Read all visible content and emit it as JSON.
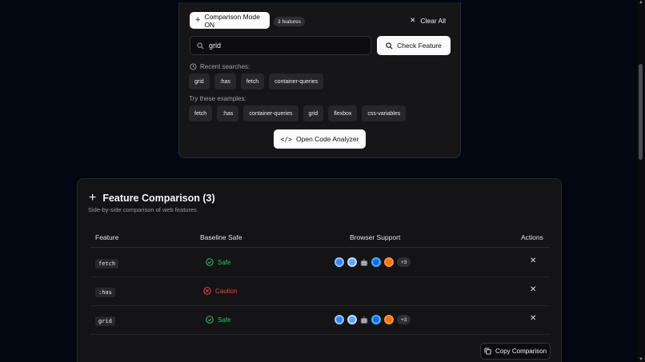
{
  "comparison_button": {
    "label": "Comparison Mode ON"
  },
  "features_badge": "3 features",
  "clear_all": "Clear All",
  "search": {
    "value": "grid",
    "placeholder": ""
  },
  "check_button": "Check Feature",
  "recent": {
    "label": "Recent searches:",
    "items": [
      "grid",
      ":has",
      "fetch",
      "container-queries"
    ]
  },
  "examples": {
    "label": "Try these examples:",
    "items": [
      "fetch",
      ":has",
      "container-queries",
      "grid",
      "flexbox",
      "css-variables"
    ]
  },
  "analyzer_button": "Open Code Analyzer",
  "comparison": {
    "title": "Feature Comparison (3)",
    "subtitle": "Side-by-side comparison of web features",
    "headers": {
      "feature": "Feature",
      "baseline": "Baseline Safe",
      "support": "Browser Support",
      "actions": "Actions"
    },
    "rows": [
      {
        "feature": "fetch",
        "status": "Safe",
        "more": "+3"
      },
      {
        "feature": ":has",
        "status": "Caution",
        "more": ""
      },
      {
        "feature": "grid",
        "status": "Safe",
        "more": "+3"
      }
    ],
    "copy_button": "Copy Comparison"
  },
  "colors": {
    "safe": "#22c55e",
    "caution": "#ef4444",
    "background": "#030711"
  }
}
